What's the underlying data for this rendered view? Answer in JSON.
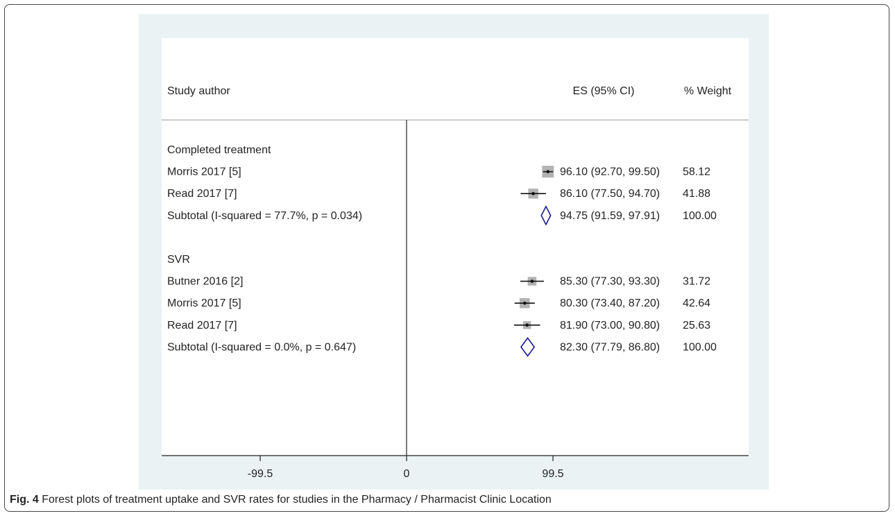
{
  "chart_data": {
    "type": "forest",
    "headers": {
      "study": "Study author",
      "es": "ES (95% CI)",
      "weight": "% Weight"
    },
    "x_ticks": [
      {
        "value": -99.5,
        "label": "-99.5"
      },
      {
        "value": 0,
        "label": "0"
      },
      {
        "value": 99.5,
        "label": "99.5"
      }
    ],
    "groups": [
      {
        "name": "Completed treatment",
        "studies": [
          {
            "label": "Morris 2017 [5]",
            "es": 96.1,
            "lo": 92.7,
            "hi": 99.5,
            "weight": 58.12,
            "text": "96.10 (92.70, 99.50)",
            "weight_text": "58.12"
          },
          {
            "label": "Read 2017 [7]",
            "es": 86.1,
            "lo": 77.5,
            "hi": 94.7,
            "weight": 41.88,
            "text": "86.10 (77.50, 94.70)",
            "weight_text": "41.88"
          }
        ],
        "subtotal": {
          "label": "Subtotal  (I-squared = 77.7%, p = 0.034)",
          "es": 94.75,
          "lo": 91.59,
          "hi": 97.91,
          "text": "94.75 (91.59, 97.91)",
          "weight_text": "100.00"
        }
      },
      {
        "name": "SVR",
        "studies": [
          {
            "label": "Butner 2016 [2]",
            "es": 85.3,
            "lo": 77.3,
            "hi": 93.3,
            "weight": 31.72,
            "text": "85.30 (77.30, 93.30)",
            "weight_text": "31.72"
          },
          {
            "label": "Morris 2017 [5]",
            "es": 80.3,
            "lo": 73.4,
            "hi": 87.2,
            "weight": 42.64,
            "text": "80.30 (73.40, 87.20)",
            "weight_text": "42.64"
          },
          {
            "label": "Read 2017 [7]",
            "es": 81.9,
            "lo": 73.0,
            "hi": 90.8,
            "weight": 25.63,
            "text": "81.90 (73.00, 90.80)",
            "weight_text": "25.63"
          }
        ],
        "subtotal": {
          "label": "Subtotal  (I-squared = 0.0%, p = 0.647)",
          "es": 82.3,
          "lo": 77.79,
          "hi": 86.8,
          "text": "82.30 (77.79, 86.80)",
          "weight_text": "100.00"
        }
      }
    ]
  },
  "caption": {
    "label": "Fig. 4",
    "text": " Forest plots of treatment uptake and SVR rates for studies in the Pharmacy / Pharmacist Clinic Location"
  }
}
